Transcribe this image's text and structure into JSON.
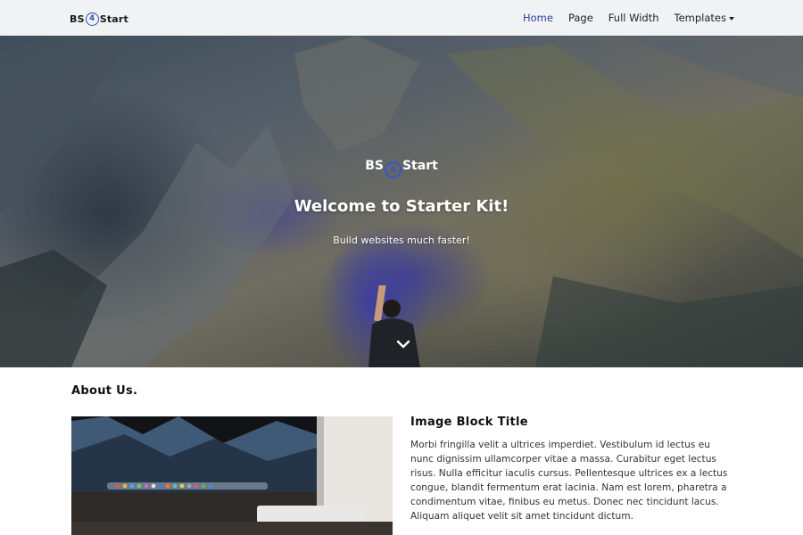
{
  "navbar": {
    "brand_left": "BS",
    "brand_four": "4",
    "brand_right": "Start",
    "links": [
      {
        "label": "Home",
        "active": true
      },
      {
        "label": "Page"
      },
      {
        "label": "Full Width"
      },
      {
        "label": "Templates",
        "has_dropdown": true
      }
    ]
  },
  "hero": {
    "logo_left": "BS",
    "logo_four": "4",
    "logo_right": "Start",
    "title": "Welcome to Starter Kit!",
    "subtitle": "Build websites much faster!",
    "scroll_icon": "chevron-down-icon"
  },
  "about": {
    "title": "About Us.",
    "block_title": "Image Block Title",
    "paragraph": "Morbi fringilla velit a ultrices imperdiet. Vestibulum id lectus eu nunc dignissim ullamcorper vitae a massa. Curabitur eget lectus risus. Nulla efficitur iaculis cursus. Pellentesque ultrices ex a lectus congue, blandit fermentum erat lacinia. Nam est lorem, pharetra a condimentum vitae, finibus eu metus. Donec nec tincidunt lacus. Aliquam aliquet velit sit amet tincidunt dictum."
  },
  "colors": {
    "accent": "#2a3fa1",
    "navbar_bg": "#f1f2f4"
  }
}
